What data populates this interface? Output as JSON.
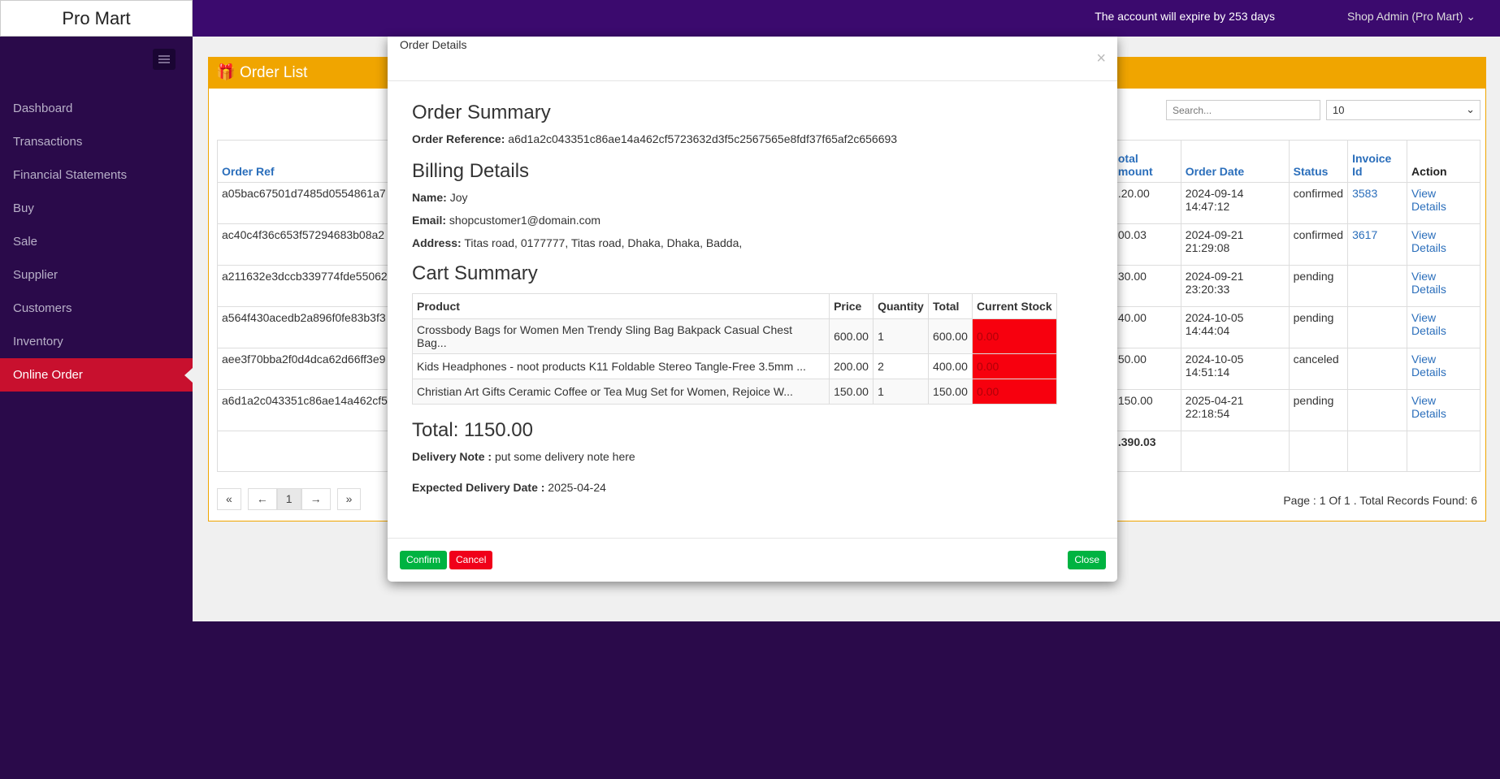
{
  "brand": "Pro Mart",
  "header": {
    "expire_notice": "The account will expire by 253 days",
    "user_menu": "Shop Admin (Pro Mart) ⌄"
  },
  "sidebar": {
    "items": [
      {
        "label": "Dashboard"
      },
      {
        "label": "Transactions"
      },
      {
        "label": "Financial Statements"
      },
      {
        "label": "Buy"
      },
      {
        "label": "Sale"
      },
      {
        "label": "Supplier"
      },
      {
        "label": "Customers"
      },
      {
        "label": "Inventory"
      },
      {
        "label": "Online Order",
        "active": true
      }
    ]
  },
  "order_list": {
    "title": "Order List",
    "search_placeholder": "Search...",
    "page_size": "10",
    "columns": {
      "order_ref": "Order Ref",
      "total_amount_line1": "otal",
      "total_amount_line2": "mount",
      "order_date": "Order Date",
      "status": "Status",
      "invoice_line1": "Invoice",
      "invoice_line2": "Id",
      "action": "Action"
    },
    "rows": [
      {
        "ref": "a05bac67501d7485d0554861a7",
        "amount": ".20.00",
        "date1": "2024-09-14",
        "date2": "14:47:12",
        "status": "confirmed",
        "invoice": "3583",
        "a1": "View",
        "a2": "Details"
      },
      {
        "ref": "ac40c4f36c653f57294683b08a2",
        "amount": "00.03",
        "date1": "2024-09-21",
        "date2": "21:29:08",
        "status": "confirmed",
        "invoice": "3617",
        "a1": "View",
        "a2": "Details"
      },
      {
        "ref": "a211632e3dccb339774fde55062",
        "amount": "30.00",
        "date1": "2024-09-21",
        "date2": "23:20:33",
        "status": "pending",
        "invoice": "",
        "a1": "View",
        "a2": "Details"
      },
      {
        "ref": "a564f430acedb2a896f0fe83b3f3",
        "amount": "40.00",
        "date1": "2024-10-05",
        "date2": "14:44:04",
        "status": "pending",
        "invoice": "",
        "a1": "View",
        "a2": "Details"
      },
      {
        "ref": "aee3f70bba2f0d4dca62d66ff3e9",
        "amount": "50.00",
        "date1": "2024-10-05",
        "date2": "14:51:14",
        "status": "canceled",
        "invoice": "",
        "a1": "View",
        "a2": "Details"
      },
      {
        "ref": "a6d1a2c043351c86ae14a462cf5",
        "amount": "150.00",
        "date1": "2025-04-21",
        "date2": "22:18:54",
        "status": "pending",
        "invoice": "",
        "a1": "View",
        "a2": "Details"
      }
    ],
    "grand_total": ".390.03",
    "pager": {
      "first": "«",
      "prev": "←",
      "current": "1",
      "next": "→",
      "last": "»"
    },
    "records_text": "Page : 1 Of 1 . Total Records Found: 6"
  },
  "modal": {
    "title": "Order Details",
    "close_symbol": "×",
    "order_summary_heading": "Order Summary",
    "order_reference_label": "Order Reference:",
    "order_reference_value": "a6d1a2c043351c86ae14a462cf5723632d3f5c2567565e8fdf37f65af2c656693",
    "billing_heading": "Billing Details",
    "name_label": "Name:",
    "name_value": "Joy",
    "email_label": "Email:",
    "email_value": "shopcustomer1@domain.com",
    "address_label": "Address:",
    "address_value": "Titas road, 0177777, Titas road, Dhaka, Dhaka, Badda,",
    "cart_heading": "Cart Summary",
    "cart_columns": {
      "product": "Product",
      "price": "Price",
      "quantity": "Quantity",
      "total": "Total",
      "stock": "Current Stock"
    },
    "cart_items": [
      {
        "product": "Crossbody Bags for Women Men Trendy Sling Bag Bakpack Casual Chest Bag...",
        "price": "600.00",
        "quantity": "1",
        "total": "600.00",
        "stock": "0.00"
      },
      {
        "product": "Kids Headphones - noot products K11 Foldable Stereo Tangle-Free 3.5mm ...",
        "price": "200.00",
        "quantity": "2",
        "total": "400.00",
        "stock": "0.00"
      },
      {
        "product": "Christian Art Gifts Ceramic Coffee or Tea Mug Set for Women, Rejoice W...",
        "price": "150.00",
        "quantity": "1",
        "total": "150.00",
        "stock": "0.00"
      }
    ],
    "total_text": "Total: 1150.00",
    "delivery_note_label": "Delivery Note :",
    "delivery_note_value": "put some delivery note here",
    "expected_label": "Expected Delivery Date :",
    "expected_value": "2025-04-24",
    "buttons": {
      "confirm": "Confirm",
      "cancel": "Cancel",
      "close": "Close"
    }
  },
  "colors": {
    "topbar": "#3b0a6e",
    "sidebar": "#2a0a4a",
    "active": "#c8102e",
    "panel": "#f0a500",
    "link": "#2a6ebb",
    "stock_alert": "#f7000e",
    "confirm": "#00b341"
  }
}
